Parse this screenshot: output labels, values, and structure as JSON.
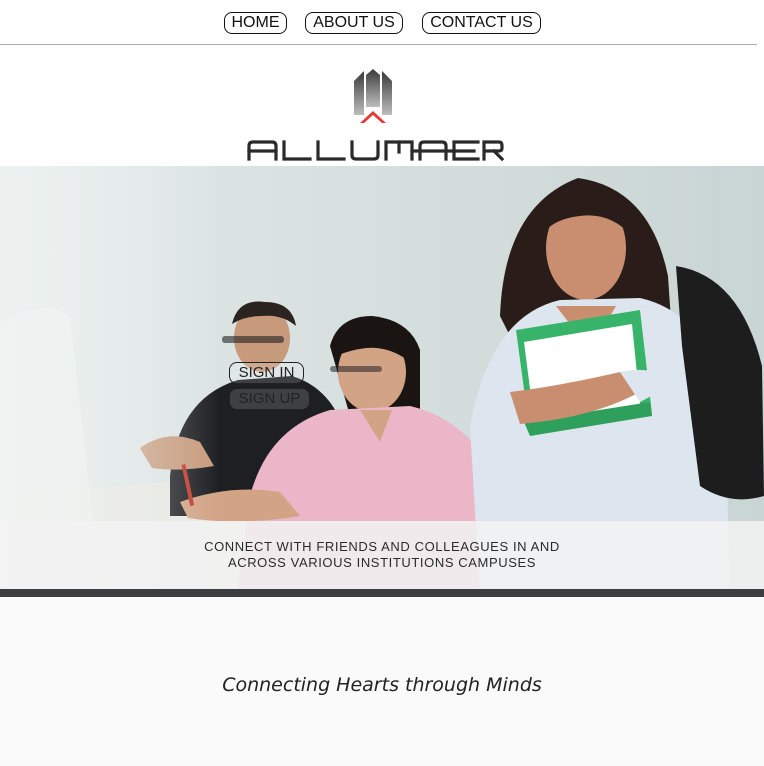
{
  "nav": {
    "home_label": "HOME",
    "about_label": "ABOUT US",
    "contact_label": "CONTACT US"
  },
  "brand": {
    "name": "ALLUMAER",
    "accent_color": "#e53935"
  },
  "hero": {
    "signin_label": "SIGN IN",
    "signup_label": "SIGN UP",
    "banner_text": "CONNECT WITH FRIENDS AND COLLEAGUES IN AND ACROSS VARIOUS INSTITUTIONS CAMPUSES"
  },
  "tagline": "Connecting Hearts through Minds"
}
